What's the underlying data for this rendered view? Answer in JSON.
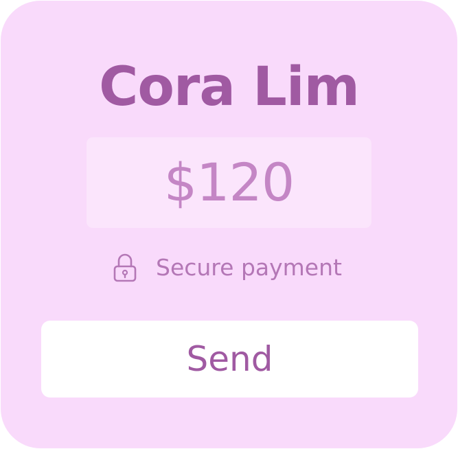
{
  "card": {
    "recipient_name": "Cora Lim",
    "amount": "$120",
    "security_note": "Secure payment",
    "security_icon": "lock-icon",
    "send_label": "Send"
  },
  "colors": {
    "card_background": "#f9dafb",
    "amount_background": "#fbe5fc",
    "accent": "#a05aa2",
    "amount_text": "#c486c5",
    "muted_text": "#b477b6",
    "button_background": "#ffffff"
  }
}
